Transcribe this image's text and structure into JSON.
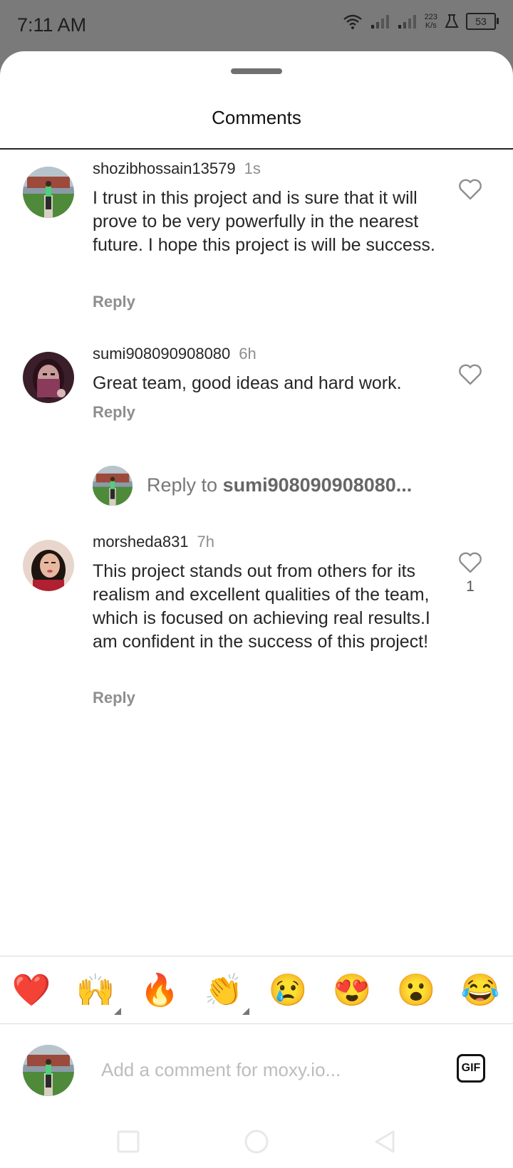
{
  "status_bar": {
    "time": "7:11 AM",
    "speed_value": "223",
    "speed_unit": "K/s",
    "battery": "53"
  },
  "sheet": {
    "title": "Comments"
  },
  "comments": [
    {
      "username": "shozibhossain13579",
      "time": "1s",
      "text": "I trust in this project and is sure that it will prove to be very powerfully in the nearest future. I hope this project is will be success.",
      "reply_label": "Reply",
      "likes": ""
    },
    {
      "username": "sumi908090908080",
      "time": "6h",
      "text": "Great team, good ideas and hard work.",
      "reply_label": "Reply",
      "likes": ""
    },
    {
      "username": "morsheda831",
      "time": "7h",
      "text": "This project stands out from others for its realism and excellent qualities of the team, which is focused on achieving real results.I am confident in the success of this project!",
      "reply_label": "Reply",
      "likes": "1"
    }
  ],
  "reply_prompt": {
    "prefix": "Reply to ",
    "target": "sumi908090908080..."
  },
  "emoji_bar": [
    {
      "name": "red-heart",
      "glyph": "❤️"
    },
    {
      "name": "raising-hands",
      "glyph": "🙌"
    },
    {
      "name": "fire",
      "glyph": "🔥"
    },
    {
      "name": "clapping-hands",
      "glyph": "👏"
    },
    {
      "name": "crying-face",
      "glyph": "😢"
    },
    {
      "name": "heart-eyes",
      "glyph": "😍"
    },
    {
      "name": "astonished-face",
      "glyph": "😮"
    },
    {
      "name": "tears-of-joy",
      "glyph": "😂"
    }
  ],
  "composer": {
    "placeholder": "Add a comment for moxy.io...",
    "gif_label": "GIF"
  },
  "icons": {
    "like": "heart-outline-icon",
    "gif": "gif-icon",
    "nav": [
      "square-icon",
      "circle-icon",
      "triangle-back-icon"
    ]
  },
  "colors": {
    "text": "#262626",
    "muted": "#8e8e8e",
    "overlay": "#7a7a7a",
    "divider": "#dbdbdb"
  }
}
